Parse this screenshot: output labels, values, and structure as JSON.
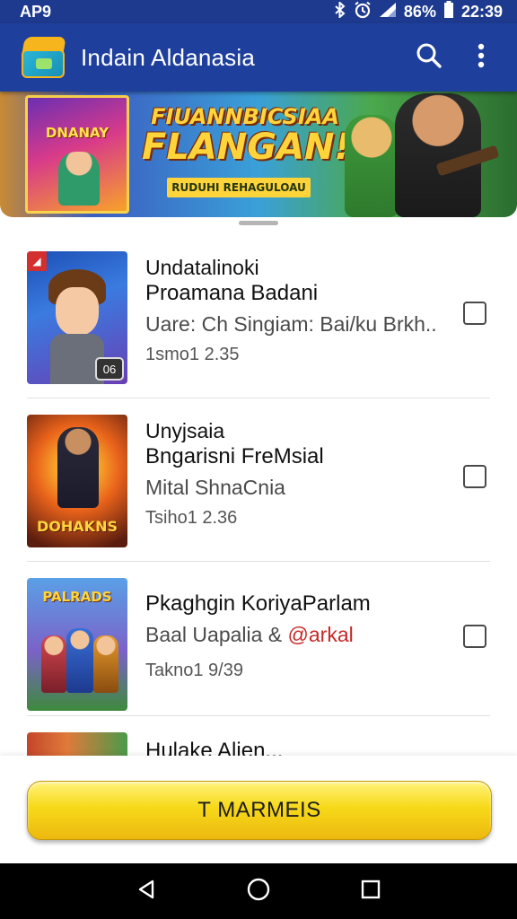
{
  "status_bar": {
    "left_text": "AP9",
    "battery_text": "86%",
    "time": "22:39",
    "icons": [
      "bluetooth-icon",
      "alarm-icon",
      "signal-icon",
      "battery-icon"
    ]
  },
  "app_bar": {
    "title": "Indain Aldanasia",
    "icons": [
      "app-logo-icon",
      "search-icon",
      "more-vert-icon"
    ],
    "color": "#1e3f9c"
  },
  "banner": {
    "mini_title": "DNANAY",
    "headline_line1": "FIUANNBICSIAA",
    "headline_line2": "FLANGAN!",
    "subtitle": "RUDUHI REHAGULOAU"
  },
  "list": {
    "items": [
      {
        "category": "Undatalinoki",
        "title": "Proamana Badani",
        "description": "Uare: Ch Singiam: Bai/ku Brkh..",
        "meta": "1smo1 2.35",
        "thumb_badge": "06",
        "checked": false
      },
      {
        "category": "Unyjsaia",
        "title": "Bngarisni FreMsial",
        "description": "Mital ShnaCnia",
        "meta": "Tsiho1 2.36",
        "thumb_caption": "DOHAKNS",
        "checked": false
      },
      {
        "title": "Pkaghgin KoriyaParlam",
        "description_main": "Baal Uapalia & ",
        "description_highlight": "@arkal",
        "meta": "Takno1 9/39",
        "thumb_caption": "PALRADS",
        "checked": false
      },
      {
        "title": "Hulake Alien..."
      }
    ]
  },
  "cta": {
    "label": "T MARMEIS",
    "color": "#f7d919"
  },
  "nav_bar": {
    "icons": [
      "back-icon",
      "home-icon",
      "recents-icon"
    ]
  }
}
